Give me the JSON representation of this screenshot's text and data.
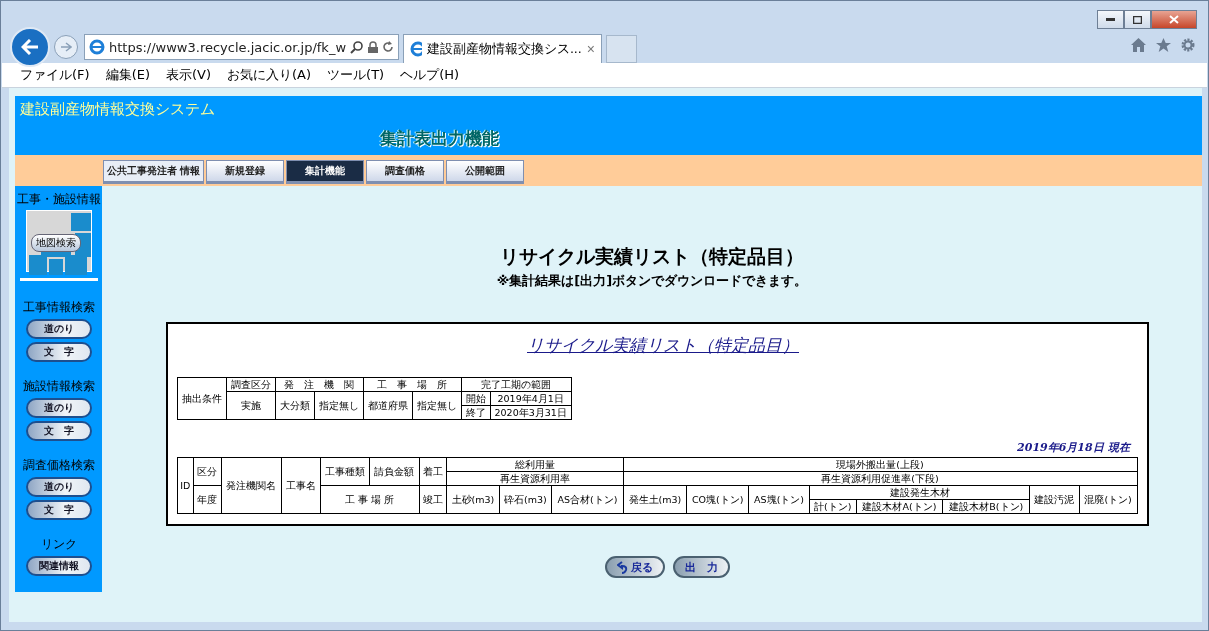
{
  "browser": {
    "address": "https://www3.recycle.jacic.or.jp/fk_w",
    "tab_title": "建設副産物情報交換シス...",
    "tab_close": "×"
  },
  "menu": [
    "ファイル(F)",
    "編集(E)",
    "表示(V)",
    "お気に入り(A)",
    "ツール(T)",
    "ヘルプ(H)"
  ],
  "header": {
    "system_name": "建設副産物情報交換システム",
    "function_title": "集計表出力機能"
  },
  "tabs": [
    {
      "label": "公共工事発注者 情報",
      "selected": false
    },
    {
      "label": "新規登録",
      "selected": false
    },
    {
      "label": "集計機能",
      "selected": true
    },
    {
      "label": "調査価格",
      "selected": false
    },
    {
      "label": "公開範囲",
      "selected": false
    }
  ],
  "sidebar": {
    "map_heading": "工事・施設情報",
    "map_button": "地図検索",
    "sections": [
      {
        "heading": "工事情報検索",
        "buttons": [
          "道のり",
          "文　字"
        ]
      },
      {
        "heading": "施設情報検索",
        "buttons": [
          "道のり",
          "文　字"
        ]
      },
      {
        "heading": "調査価格検索",
        "buttons": [
          "道のり",
          "文　字"
        ]
      },
      {
        "heading": "リンク",
        "buttons": [
          "関連情報"
        ]
      }
    ]
  },
  "page_title": "リサイクル実績リスト（特定品目）",
  "page_note": "※集計結果は[出力]ボタンでダウンロードできます。",
  "report": {
    "title": "リサイクル実績リスト（特定品目）",
    "conditions": [
      [
        {
          "text": "抽出条件",
          "rowspan": 3
        },
        {
          "text": "調査区分"
        },
        {
          "text": "発　注　機　関",
          "colspan": 2
        },
        {
          "text": "工　事　場　所",
          "colspan": 2
        },
        {
          "text": "完了工期の範囲",
          "colspan": 2
        }
      ],
      [
        {
          "text": "実施",
          "rowspan": 2
        },
        {
          "text": "大分類",
          "rowspan": 2
        },
        {
          "text": "指定無し",
          "rowspan": 2
        },
        {
          "text": "都道府県",
          "rowspan": 2
        },
        {
          "text": "指定無し",
          "rowspan": 2
        },
        {
          "text": "開始"
        },
        {
          "text": "2019年4月1日"
        }
      ],
      [
        {
          "text": "終了"
        },
        {
          "text": "2020年3月31日"
        }
      ]
    ],
    "as_of": "2019年6月18日 現在",
    "columns": [
      [
        {
          "text": "ID",
          "rowspan": 4
        },
        {
          "text": "区分",
          "rowspan": 2
        },
        {
          "text": "発注機関名",
          "rowspan": 4
        },
        {
          "text": "工事名",
          "rowspan": 4
        },
        {
          "text": "工事種類",
          "rowspan": 2
        },
        {
          "text": "請負金額",
          "rowspan": 2
        },
        {
          "text": "着工",
          "rowspan": 2
        },
        {
          "text": "総利用量",
          "colspan": 3
        },
        {
          "text": "現場外搬出量(上段)",
          "colspan": 8
        }
      ],
      [
        {
          "text": "再生資源利用率",
          "colspan": 3
        },
        {
          "text": "再生資源利用促進率(下段)",
          "colspan": 8
        }
      ],
      [
        {
          "text": "年度",
          "rowspan": 2
        },
        {
          "text": "工 事 場 所",
          "rowspan": 2,
          "colspan": 2
        },
        {
          "text": "竣工",
          "rowspan": 2
        },
        {
          "text": "土砂(m3)",
          "rowspan": 2
        },
        {
          "text": "砕石(m3)",
          "rowspan": 2
        },
        {
          "text": "AS合材(トン)",
          "rowspan": 2
        },
        {
          "text": "発生土(m3)",
          "rowspan": 2
        },
        {
          "text": "CO塊(トン)",
          "rowspan": 2
        },
        {
          "text": "AS塊(トン)",
          "rowspan": 2
        },
        {
          "text": "建設発生木材",
          "colspan": 3
        },
        {
          "text": "建設汚泥",
          "rowspan": 2
        },
        {
          "text": "混廃(トン)",
          "rowspan": 2
        }
      ],
      [
        {
          "text": "計(トン)"
        },
        {
          "text": "建設木材A(トン)"
        },
        {
          "text": "建設木材B(トン)"
        }
      ]
    ]
  },
  "buttons": [
    {
      "kind": "back",
      "label": "戻る"
    },
    {
      "kind": "output",
      "label": "出　力"
    }
  ]
}
